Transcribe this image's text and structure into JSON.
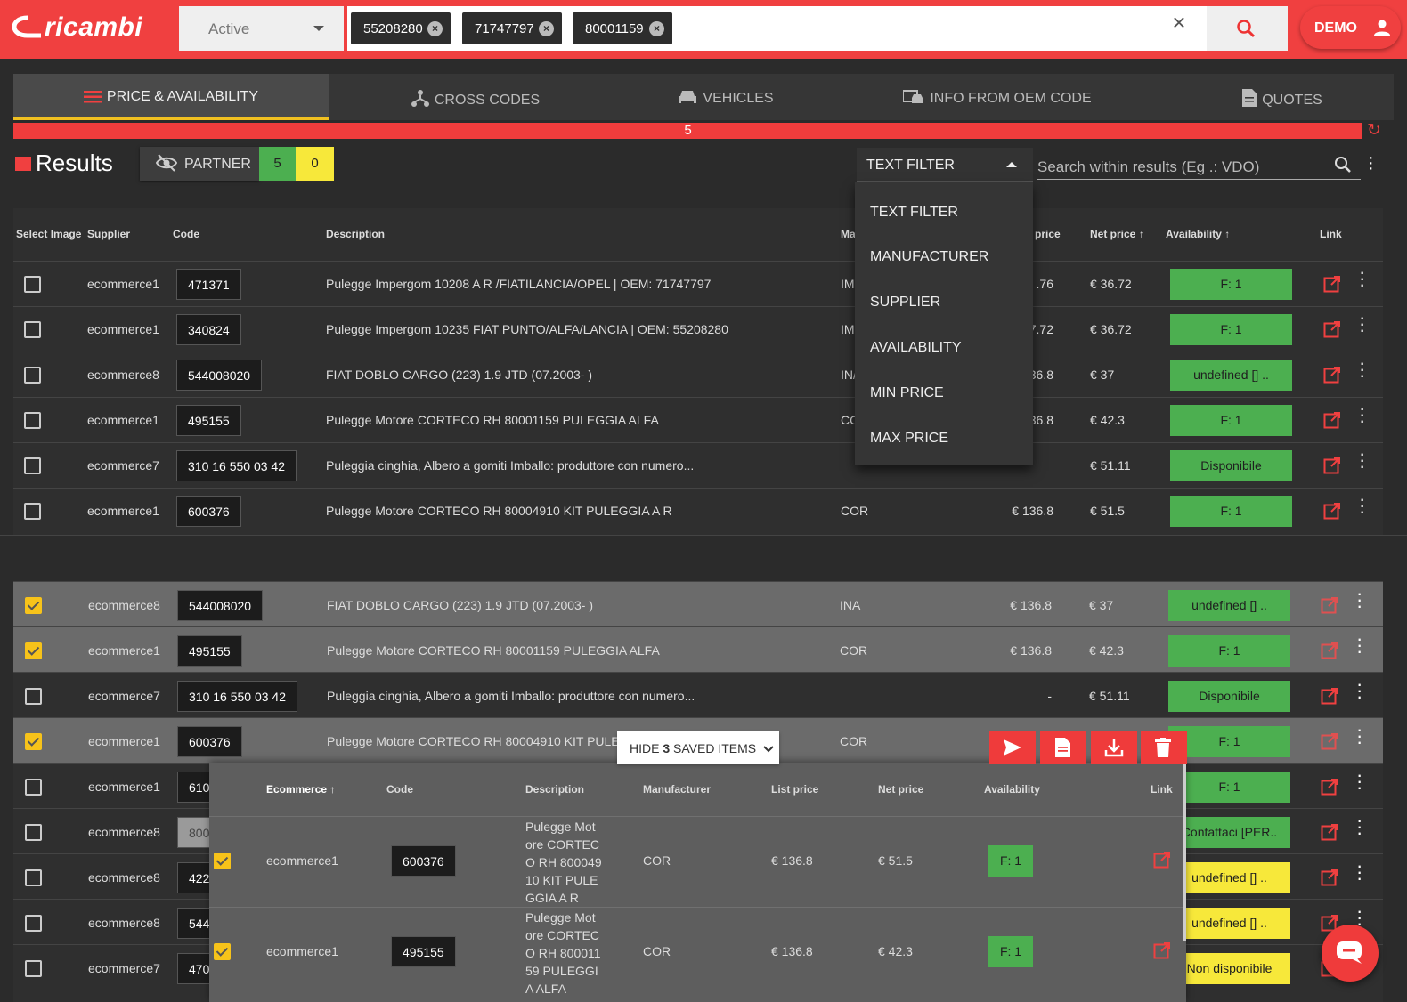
{
  "app": {
    "logo": "ricambi",
    "status": "Active",
    "chips": [
      "55208280",
      "71747797",
      "80001159"
    ],
    "user": "DEMO"
  },
  "tabs": [
    {
      "label": "PRICE & AVAILABILITY"
    },
    {
      "label": "CROSS CODES"
    },
    {
      "label": "VEHICLES"
    },
    {
      "label": "INFO FROM OEM CODE"
    },
    {
      "label": "QUOTES"
    }
  ],
  "progress": {
    "label": "5",
    "percent": 100
  },
  "results": {
    "title": "Results",
    "partner_label": "PARTNER",
    "count_green": "5",
    "count_yellow": "0",
    "filter_selected": "TEXT FILTER",
    "search_placeholder": "Search within results (Eg .: VDO)"
  },
  "filter_menu": [
    "TEXT FILTER",
    "MANUFACTURER",
    "SUPPLIER",
    "AVAILABILITY",
    "MIN PRICE",
    "MAX PRICE"
  ],
  "table_headers": {
    "select_image": "Select Image",
    "supplier": "Supplier",
    "code": "Code",
    "description": "Description",
    "manufacturer": "Ma",
    "list_price": "price",
    "net_price": "Net price",
    "availability": "Availability",
    "link": "Link"
  },
  "rows_top": [
    {
      "supplier": "ecommerce1",
      "code": "471371",
      "description": "Pulegge Impergom 10208 A R /FIATILANCIA/OPEL | OEM: 71747797",
      "manufacturer": "IM",
      "list_price": ".76",
      "net_price": "€ 36.72",
      "availability": "F: 1",
      "avail_color": "green"
    },
    {
      "supplier": "ecommerce1",
      "code": "340824",
      "description": "Pulegge Impergom 10235 FIAT PUNTO/ALFA/LANCIA | OEM: 55208280",
      "manufacturer": "IM",
      "list_price": "7.72",
      "net_price": "€ 36.72",
      "availability": "F: 1",
      "avail_color": "green"
    },
    {
      "supplier": "ecommerce8",
      "code": "544008020",
      "description": "FIAT DOBLO CARGO (223) 1.9 JTD (07.2003- )",
      "manufacturer": "IN/",
      "list_price": "36.8",
      "net_price": "€ 37",
      "availability": "undefined [] ..",
      "avail_color": "green"
    },
    {
      "supplier": "ecommerce1",
      "code": "495155",
      "description": "Pulegge Motore CORTECO RH 80001159 PULEGGIA ALFA",
      "manufacturer": "CC",
      "list_price": "36.8",
      "net_price": "€ 42.3",
      "availability": "F: 1",
      "avail_color": "green"
    },
    {
      "supplier": "ecommerce7",
      "code": "310 16 550 03 42",
      "description": "Puleggia cinghia, Albero a gomiti Imballo: produttore con numero...",
      "manufacturer": "",
      "list_price": "",
      "net_price": "€ 51.11",
      "availability": "Disponibile",
      "avail_color": "green"
    },
    {
      "supplier": "ecommerce1",
      "code": "600376",
      "description": "Pulegge Motore CORTECO RH 80004910 KIT PULEGGIA A R",
      "manufacturer": "COR",
      "list_price": "€ 136.8",
      "net_price": "€ 51.5",
      "availability": "F: 1",
      "avail_color": "green"
    }
  ],
  "rows_bottom": [
    {
      "checked": true,
      "supplier": "ecommerce8",
      "code": "544008020",
      "description": "FIAT DOBLO CARGO (223) 1.9 JTD (07.2003- )",
      "manufacturer": "INA",
      "list_price": "€ 136.8",
      "net_price": "€ 37",
      "availability": "undefined [] ..",
      "avail_color": "green"
    },
    {
      "checked": true,
      "supplier": "ecommerce1",
      "code": "495155",
      "description": "Pulegge Motore CORTECO RH 80001159 PULEGGIA ALFA",
      "manufacturer": "COR",
      "list_price": "€ 136.8",
      "net_price": "€ 42.3",
      "availability": "F: 1",
      "avail_color": "green"
    },
    {
      "checked": false,
      "supplier": "ecommerce7",
      "code": "310 16 550 03 42",
      "description": "Puleggia cinghia, Albero a gomiti Imballo: produttore con numero...",
      "manufacturer": "",
      "list_price": "-",
      "net_price": "€ 51.11",
      "availability": "Disponibile",
      "avail_color": "green"
    },
    {
      "checked": true,
      "supplier": "ecommerce1",
      "code": "600376",
      "description": "Pulegge Motore CORTECO RH 80004910 KIT PULEGG",
      "manufacturer": "COR",
      "list_price": "€",
      "net_price": "",
      "availability": "F: 1",
      "avail_color": "green"
    },
    {
      "checked": false,
      "supplier": "ecommerce1",
      "code": "610",
      "description": "",
      "manufacturer": "",
      "list_price": "",
      "net_price": "",
      "availability": "F: 1",
      "avail_color": "green"
    },
    {
      "checked": false,
      "supplier": "ecommerce8",
      "code": "800",
      "description": "",
      "manufacturer": "",
      "list_price": "",
      "net_price": "",
      "availability": "Contattaci [PER..",
      "avail_color": "green"
    },
    {
      "checked": false,
      "supplier": "ecommerce8",
      "code": "422",
      "description": "",
      "manufacturer": "",
      "list_price": "",
      "net_price": "",
      "availability": "undefined [] ..",
      "avail_color": "yellow"
    },
    {
      "checked": false,
      "supplier": "ecommerce8",
      "code": "544",
      "description": "",
      "manufacturer": "",
      "list_price": "",
      "net_price": "",
      "availability": "undefined [] ..",
      "avail_color": "yellow"
    },
    {
      "checked": false,
      "supplier": "ecommerce7",
      "code": "470",
      "description": "",
      "manufacturer": "",
      "list_price": "",
      "net_price": "",
      "availability": "Non disponibile",
      "avail_color": "yellow"
    }
  ],
  "saved": {
    "hide_label_pre": "HIDE",
    "hide_count": "3",
    "hide_label_post": "SAVED ITEMS",
    "headers": {
      "ecommerce": "Ecommerce",
      "code": "Code",
      "description": "Description",
      "manufacturer": "Manufacturer",
      "list_price": "List price",
      "net_price": "Net price",
      "availability": "Availability",
      "link": "Link"
    },
    "rows": [
      {
        "supplier": "ecommerce1",
        "code": "600376",
        "description_lines": [
          "Pulegge Mot",
          "ore CORTEC",
          "O RH 800049",
          "10 KIT PULE",
          "GGIA A R"
        ],
        "manufacturer": "COR",
        "list_price": "€ 136.8",
        "net_price": "€ 51.5",
        "availability": "F: 1"
      },
      {
        "supplier": "ecommerce1",
        "code": "495155",
        "description_lines": [
          "Pulegge Mot",
          "ore CORTEC",
          "O RH 800011",
          "59 PULEGGI",
          "A ALFA"
        ],
        "manufacturer": "COR",
        "list_price": "€ 136.8",
        "net_price": "€ 42.3",
        "availability": "F: 1"
      }
    ]
  }
}
